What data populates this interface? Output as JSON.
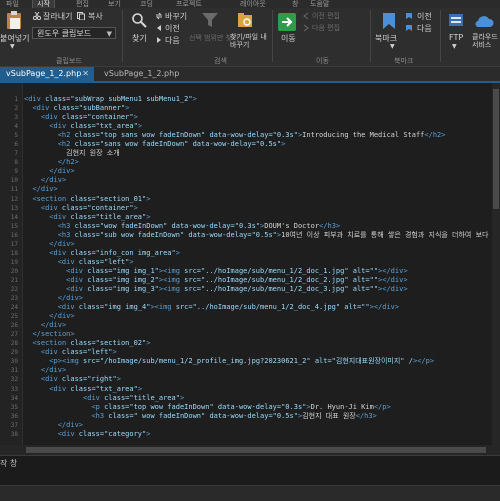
{
  "menu": {
    "items": [
      "파일",
      "시작",
      "편집",
      "보기",
      "코딩",
      "프로젝트",
      "레이아웃",
      "창",
      "도움말"
    ]
  },
  "ribbon": {
    "paste_label": "붙여넣기",
    "dropdown_arrow": "▼",
    "cut_label": "잘라내기",
    "copy_label": "복사",
    "clipboard_select": "윈도우 클립보드",
    "clipboard_group": "클립보드",
    "find_label": "찾기",
    "replace_label": "바꾸기",
    "prev_label": "이전",
    "next_label": "다음",
    "filter_label": "선택 범위만 찾기",
    "findfile_label": "찾기/파일 내 바꾸기",
    "search_group": "검색",
    "goto_label": "이동",
    "back_label": "이전 편집",
    "forward_label": "다음 편집",
    "move_group": "이동",
    "bookmark_label": "북마크",
    "bm_prev_label": "이전",
    "bm_next_label": "다음",
    "bookmark_group": "북마크",
    "ftp_label": "FTP",
    "cloud_label": "클라우드 서비스"
  },
  "tabs": [
    {
      "label": "vSubPage_1_2.php",
      "active": true
    },
    {
      "label": "vSubPage_1_2.php",
      "active": false
    }
  ],
  "tab_close": "✕",
  "status": {
    "output_label": "작 창"
  },
  "code_lines": [
    "<div class=\"subWrap subMenu1 subMenu1_2\">",
    "  <div class=\"subBanner\">",
    "    <div class=\"container\">",
    "      <div class=\"txt_area\">",
    "        <h2 class=\"top sans wow fadeInDown\" data-wow-delay=\"0.3s\">Introducing the Medical Staff</h2>",
    "        <h2 class=\"sans wow fadeInDown\" data-wow-delay=\"0.5s\">",
    "          김현지 원장 소개",
    "        </h2>",
    "      </div>",
    "    </div>",
    "  </div>",
    "  <section class=\"section_01\">",
    "    <div class=\"container\">",
    "      <div class=\"title_area\">",
    "        <h3 class=\"wow fadeInDown\" data-wow-delay=\"0.3s\">DOUM's Doctor</h3>",
    "        <h3 class=\"sub wow fadeInDown\" data-wow-delay=\"0.5s\">10여년 이상 피부과 치료를 통해 쌓은 경험과 지식을 더하여 보다 더",
    "      </div>",
    "      <div class=\"info_con img_area\">",
    "        <div class=\"left\">",
    "          <div class=\"img img_1\"><img src=\"../hoImage/sub/menu_1/2_doc_1.jpg\" alt=\"\"></div>",
    "          <div class=\"img img_2\"><img src=\"../hoImage/sub/menu_1/2_doc_2.jpg\" alt=\"\"></div>",
    "          <div class=\"img img_3\"><img src=\"../hoImage/sub/menu_1/2_doc_3.jpg\" alt=\"\"></div>",
    "        </div>",
    "        <div class=\"img img_4\"><img src=\"../hoImage/sub/menu_1/2_doc_4.jpg\" alt=\"\"></div>",
    "      </div>",
    "    </div>",
    "  </section>",
    "  <section class=\"section_02\">",
    "    <div class=\"left\">",
    "      <p><img src=\"/hoImage/sub/menu_1/2_profile_img.jpg?20230621_2\" alt=\"김현지대표원장이미지\" /></p>",
    "    </div>",
    "    <div class=\"right\">",
    "      <div class=\"txt_area\">",
    "              <div class=\"title_area\">",
    "                <p class=\"top wow fadeInDown\" data-wow-delay=\"0.3s\">Dr. Hyun-Ji Kim</p>",
    "                <h3 class=\" wow fadeInDown\" data-wow-delay=\"0.5s\">김현지 대표 원장</h3>",
    "        </div>",
    "        <div class=\"category\">"
  ],
  "line_numbers": [
    "1",
    "2",
    "3",
    "4",
    "5",
    "6",
    "7",
    "8",
    "9",
    "10",
    "11",
    "12",
    "13",
    "14",
    "15",
    "16",
    "17",
    "18",
    "19",
    "20",
    "21",
    "22",
    "23",
    "24",
    "25",
    "26",
    "27",
    "28",
    "29",
    "30",
    "31",
    "32",
    "33",
    "34",
    "35",
    "36",
    "37",
    "38"
  ],
  "colors": {
    "tab_active": "#1f5e8e",
    "tag": "#5aa0d6",
    "attribute": "#9cdcfe",
    "string": "#d69d6e",
    "goto_green": "#2e9d4a"
  }
}
